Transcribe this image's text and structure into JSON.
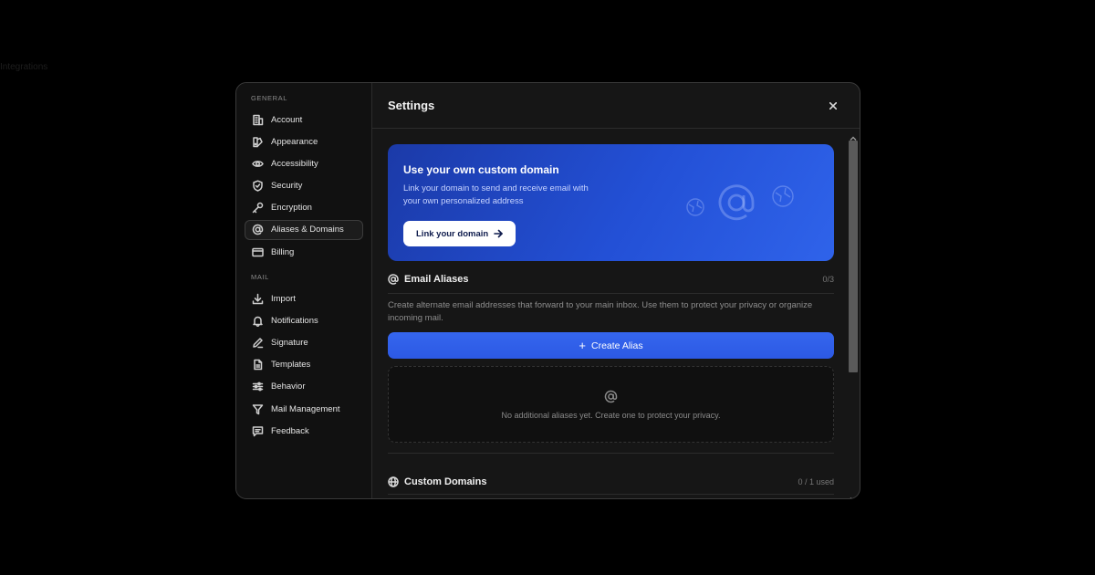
{
  "ghost_text": "Integrations",
  "sidebar": {
    "general_label": "GENERAL",
    "general_items": [
      {
        "label": "Account",
        "icon": "building-icon"
      },
      {
        "label": "Appearance",
        "icon": "palette-icon"
      },
      {
        "label": "Accessibility",
        "icon": "eye-icon"
      },
      {
        "label": "Security",
        "icon": "shield-icon"
      },
      {
        "label": "Encryption",
        "icon": "key-icon"
      },
      {
        "label": "Aliases & Domains",
        "icon": "at-sign-icon",
        "active": true
      },
      {
        "label": "Billing",
        "icon": "credit-card-icon"
      }
    ],
    "mail_label": "MAIL",
    "mail_items": [
      {
        "label": "Import",
        "icon": "download-icon"
      },
      {
        "label": "Notifications",
        "icon": "bell-icon"
      },
      {
        "label": "Signature",
        "icon": "pen-icon"
      },
      {
        "label": "Templates",
        "icon": "file-icon"
      },
      {
        "label": "Behavior",
        "icon": "sliders-icon"
      },
      {
        "label": "Mail Management",
        "icon": "filter-icon"
      },
      {
        "label": "Feedback",
        "icon": "message-icon"
      }
    ]
  },
  "header": {
    "title": "Settings"
  },
  "banner": {
    "title": "Use your own custom domain",
    "subtitle": "Link your domain to send and receive email with your own personalized address",
    "button_label": "Link your domain"
  },
  "aliases": {
    "title": "Email Aliases",
    "count": "0/3",
    "description": "Create alternate email addresses that forward to your main inbox. Use them to protect your privacy or organize incoming mail.",
    "create_label": "Create Alias",
    "empty_text": "No additional aliases yet. Create one to protect your privacy."
  },
  "domains": {
    "title": "Custom Domains",
    "count": "0 / 1 used"
  },
  "colors": {
    "accent": "#2c59e4",
    "banner_start": "#1b3aa8",
    "banner_end": "#2f63ea",
    "background": "#161616"
  }
}
